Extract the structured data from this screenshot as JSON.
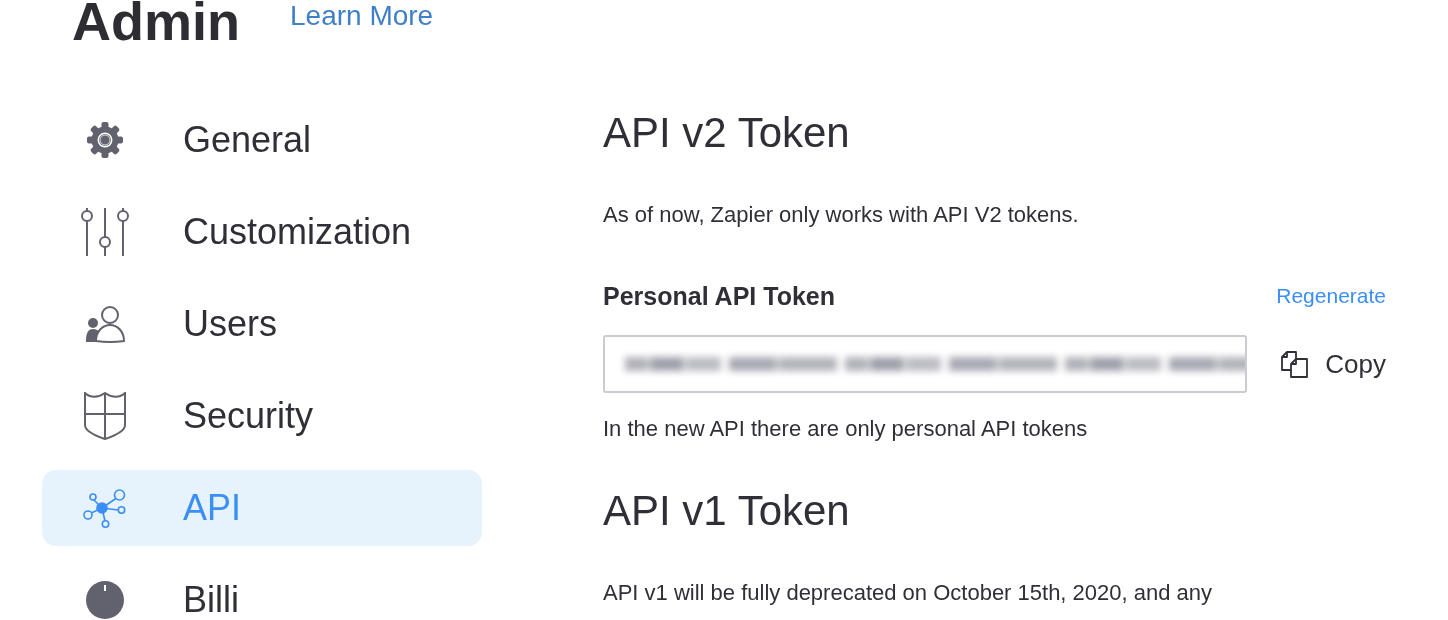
{
  "header": {
    "title": "Admin",
    "link": "Learn More"
  },
  "sidebar": {
    "items": [
      {
        "label": "General",
        "selected": false
      },
      {
        "label": "Customization",
        "selected": false
      },
      {
        "label": "Users",
        "selected": false
      },
      {
        "label": "Security",
        "selected": false
      },
      {
        "label": "API",
        "selected": true
      },
      {
        "label": "Billi",
        "selected": false
      }
    ]
  },
  "api_v2": {
    "title": "API v2 Token",
    "note": "As of now, Zapier only works with API V2 tokens.",
    "token": {
      "label": "Personal API Token",
      "regenerate": "Regenerate",
      "copy": "Copy",
      "help": "In the new API there are only personal API tokens"
    }
  },
  "api_v1": {
    "title": "API v1 Token",
    "note": "API v1 will be fully deprecated on October 15th, 2020, and any"
  }
}
